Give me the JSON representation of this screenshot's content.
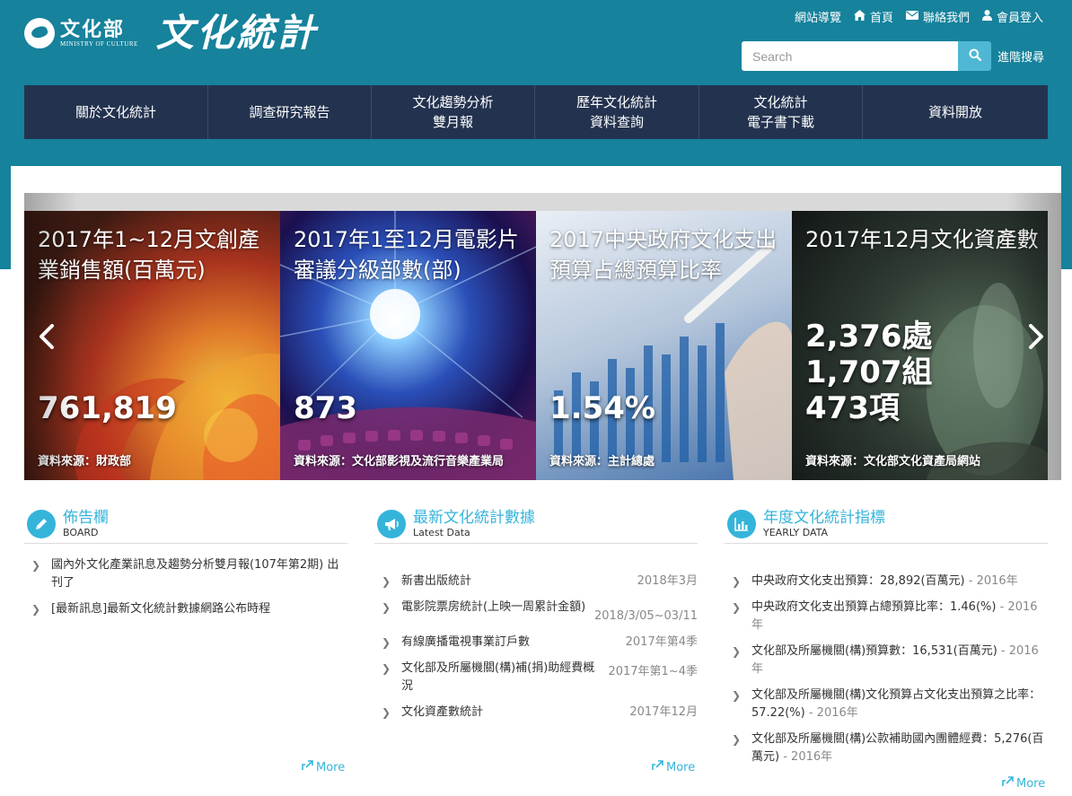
{
  "header": {
    "logo": {
      "ministry_cn": "文化部",
      "ministry_en": "MINISTRY OF CULTURE",
      "site_title": "文化統計"
    },
    "top_links": [
      {
        "label": "網站導覽",
        "icon": "none"
      },
      {
        "label": "首頁",
        "icon": "home-icon"
      },
      {
        "label": "聯絡我們",
        "icon": "envelope-icon"
      },
      {
        "label": "會員登入",
        "icon": "user-icon"
      }
    ],
    "search": {
      "placeholder": "Search",
      "value": "",
      "advanced_label": "進階搜尋"
    }
  },
  "nav": [
    {
      "label": "關於文化統計"
    },
    {
      "label": "調查研究報告"
    },
    {
      "label": "文化趨勢分析\n雙月報"
    },
    {
      "label": "歷年文化統計\n資料查詢"
    },
    {
      "label": "文化統計\n電子書下載"
    },
    {
      "label": "資料開放"
    }
  ],
  "slider": {
    "slides": [
      {
        "title": "2017年1~12月文創產業銷售額(百萬元)",
        "value": "761,819",
        "source": "資料來源：財政部"
      },
      {
        "title": "2017年1至12月電影片審議分級部數(部)",
        "value": "873",
        "source": "資料來源：文化部影視及流行音樂產業局"
      },
      {
        "title": "2017中央政府文化支出預算占總預算比率",
        "value": "1.54%",
        "source": "資料來源：主計總處"
      },
      {
        "title": "2017年12月文化資產數",
        "value": "2,376處\n1,707組\n473項",
        "source": "資料來源：文化部文化資產局網站"
      }
    ]
  },
  "panels": {
    "board": {
      "title": "佈告欄",
      "subtitle": "BOARD",
      "icon": "pencil-icon",
      "items": [
        {
          "text": "國內外文化產業訊息及趨勢分析雙月報(107年第2期) 出刊了"
        },
        {
          "text": "[最新訊息]最新文化統計數據網路公布時程"
        }
      ],
      "more": "More"
    },
    "latest": {
      "title": "最新文化統計數據",
      "subtitle": "Latest Data",
      "icon": "megaphone-icon",
      "items": [
        {
          "text": "新書出版統計",
          "date": "2018年3月"
        },
        {
          "text": "電影院票房統計(上映一周累計金額)",
          "date": "2018/3/05~03/11"
        },
        {
          "text": "有線廣播電視事業訂戶數",
          "date": "2017年第4季"
        },
        {
          "text": "文化部及所屬機關(構)補(捐)助經費概況",
          "date": "2017年第1~4季"
        },
        {
          "text": "文化資產數統計",
          "date": "2017年12月"
        }
      ],
      "more": "More"
    },
    "yearly": {
      "title": "年度文化統計指標",
      "subtitle": "YEARLY DATA",
      "icon": "bar-chart-icon",
      "items": [
        {
          "text": "中央政府文化支出預算：28,892(百萬元)",
          "year": "- 2016年"
        },
        {
          "text": "中央政府文化支出預算占總預算比率：1.46(%)",
          "year": "- 2016年"
        },
        {
          "text": "文化部及所屬機關(構)預算數：16,531(百萬元)",
          "year": "- 2016年"
        },
        {
          "text": "文化部及所屬機關(構)文化預算占文化支出預算之比率：57.22(%)",
          "year": "- 2016年"
        },
        {
          "text": "文化部及所屬機關(構)公款補助國內團體經費：5,276(百萬元)",
          "year": "- 2016年"
        }
      ],
      "more": "More"
    }
  },
  "colors": {
    "header_bg": "#16829c",
    "nav_bg": "#23334f",
    "accent": "#35b4da"
  }
}
